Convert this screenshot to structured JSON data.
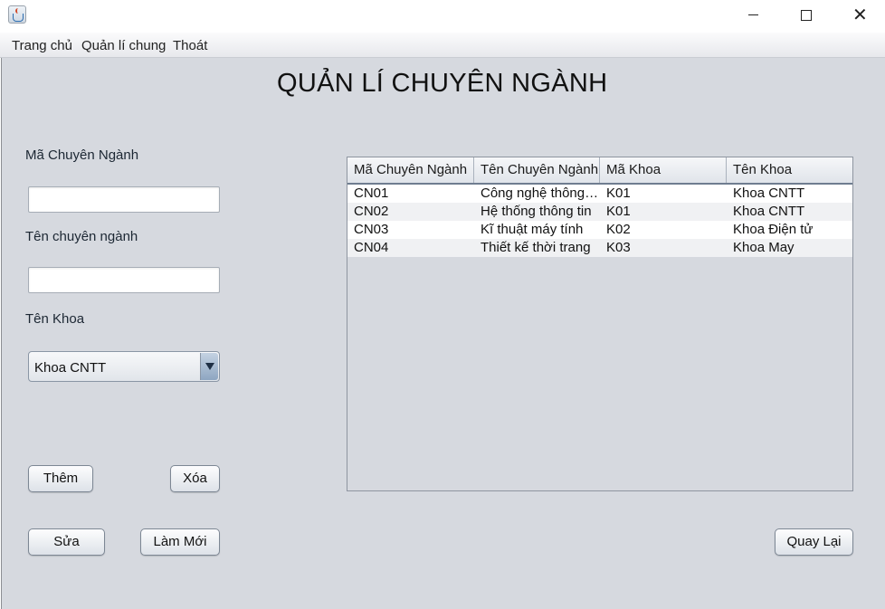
{
  "window": {
    "app_icon": "java-coffee-icon",
    "controls": {
      "minimize_icon": "minimize-icon",
      "maximize_icon": "maximize-icon",
      "close_icon": "close-icon",
      "close_glyph": "✕"
    }
  },
  "menu": {
    "items": [
      {
        "label": "Trang chủ"
      },
      {
        "label": "Quản lí chung"
      },
      {
        "label": "Thoát"
      }
    ]
  },
  "page": {
    "title": "QUẢN LÍ CHUYÊN NGÀNH"
  },
  "form": {
    "ma_label": "Mã Chuyên Ngành",
    "ma_value": "",
    "ten_label": "Tên chuyên ngành",
    "ten_value": "",
    "khoa_label": "Tên Khoa",
    "khoa_selected": "Khoa CNTT"
  },
  "buttons": {
    "them": "Thêm",
    "xoa": "Xóa",
    "sua": "Sửa",
    "lam_moi": "Làm Mới",
    "quay_lai": "Quay Lại"
  },
  "table": {
    "columns": [
      "Mã Chuyên Ngành",
      "Tên Chuyên Ngành",
      "Mã Khoa",
      "Tên Khoa"
    ],
    "rows": [
      [
        "CN01",
        "Công nghệ thông t...",
        "K01",
        "Khoa CNTT"
      ],
      [
        "CN02",
        "Hệ thống thông tin",
        "K01",
        "Khoa CNTT"
      ],
      [
        "CN03",
        "Kĩ thuật máy tính",
        "K02",
        "Khoa Điện tử"
      ],
      [
        "CN04",
        "Thiết kế thời trang",
        "K03",
        "Khoa May"
      ]
    ]
  },
  "colors": {
    "panel_bg": "#d6d9df",
    "header_underline": "#6f7d90",
    "combo_arrow": "#8ea6c1"
  }
}
